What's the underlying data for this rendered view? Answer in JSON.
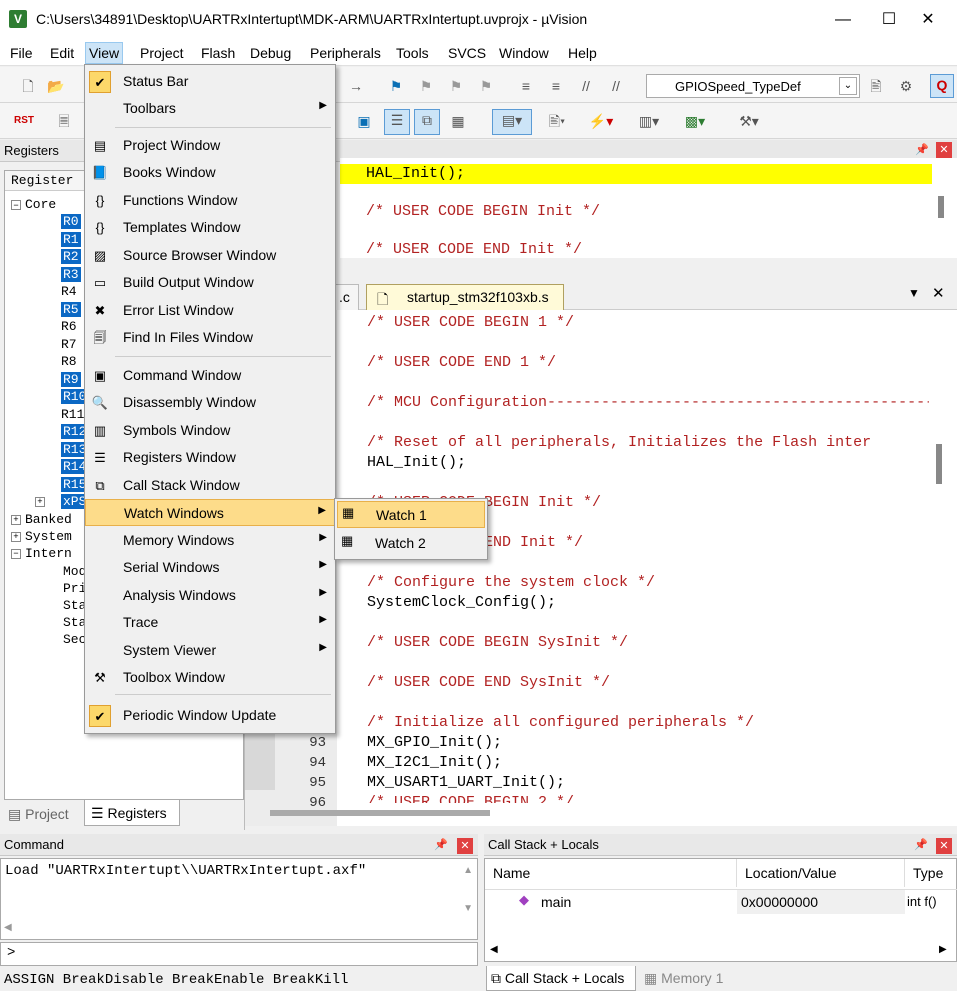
{
  "window": {
    "title": "C:\\Users\\34891\\Desktop\\UARTRxIntertupt\\MDK-ARM\\UARTRxIntertupt.uvprojx - µVision",
    "minimize": "—",
    "maximize": "☐",
    "close": "✕"
  },
  "menubar": [
    "File",
    "Edit",
    "View",
    "Project",
    "Flash",
    "Debug",
    "Peripherals",
    "Tools",
    "SVCS",
    "Window",
    "Help"
  ],
  "toolbar": {
    "target": "GPIOSpeed_TypeDef",
    "rst_label": "RST"
  },
  "view_menu": {
    "items": [
      {
        "label": "Status Bar",
        "checked": true
      },
      {
        "label": "Toolbars",
        "submenu": true
      },
      {
        "label": "Project Window"
      },
      {
        "label": "Books Window"
      },
      {
        "label": "Functions Window"
      },
      {
        "label": "Templates Window"
      },
      {
        "label": "Source Browser Window"
      },
      {
        "label": "Build Output Window"
      },
      {
        "label": "Error List Window"
      },
      {
        "label": "Find In Files Window"
      },
      {
        "label": "Command Window"
      },
      {
        "label": "Disassembly Window"
      },
      {
        "label": "Symbols Window"
      },
      {
        "label": "Registers Window"
      },
      {
        "label": "Call Stack Window"
      },
      {
        "label": "Watch Windows",
        "submenu": true,
        "highlighted": true
      },
      {
        "label": "Memory Windows",
        "submenu": true
      },
      {
        "label": "Serial Windows",
        "submenu": true
      },
      {
        "label": "Analysis Windows",
        "submenu": true
      },
      {
        "label": "Trace",
        "submenu": true
      },
      {
        "label": "System Viewer",
        "submenu": true
      },
      {
        "label": "Toolbox Window"
      },
      {
        "label": "Periodic Window Update",
        "checked": true
      }
    ]
  },
  "watch_submenu": [
    "Watch 1",
    "Watch 2"
  ],
  "registers_panel": {
    "title": "Registers",
    "column": "Register",
    "core": "Core",
    "regs": [
      "R0",
      "R1",
      "R2",
      "R3",
      "R4",
      "R5",
      "R6",
      "R7",
      "R8",
      "R9",
      "R10",
      "R11",
      "R12",
      "R13",
      "R14",
      "R15",
      "xPSR"
    ],
    "selected": [
      "R0",
      "R1",
      "R2",
      "R3",
      "R5",
      "R9",
      "R10",
      "R12",
      "R13",
      "R14",
      "R15",
      "xPSR"
    ],
    "groups": [
      "Banked",
      "System",
      "Intern"
    ],
    "internal": [
      "Mod",
      "Pri",
      "Sta",
      "Sta",
      "Sec"
    ],
    "tab_project": "Project",
    "tab_registers": "Registers"
  },
  "upper_editor": [
    "HAL_Init();",
    "/* USER CODE BEGIN Init */",
    "/* USER CODE END Init */"
  ],
  "editor_tabs": [
    ".c",
    "startup_stm32f103xb.s"
  ],
  "main_editor": {
    "lines": [
      {
        "text": "/* USER CODE BEGIN 1 */",
        "comment": true
      },
      {
        "text": "",
        "comment": false
      },
      {
        "text": "/* USER CODE END 1 */",
        "comment": true
      },
      {
        "text": "",
        "comment": false
      },
      {
        "text": "/* MCU Configuration--------------------------------------------------------",
        "comment": true
      },
      {
        "text": "",
        "comment": false
      },
      {
        "text": "/* Reset of all peripherals, Initializes the Flash inter",
        "comment": true
      },
      {
        "text": "HAL_Init();",
        "comment": false
      },
      {
        "text": "",
        "comment": false
      },
      {
        "text": "/* USER CODE BEGIN Init */",
        "comment": true
      },
      {
        "text": "",
        "comment": false
      },
      {
        "text": "/* USER CODE END Init */",
        "comment": true
      },
      {
        "text": "",
        "comment": false
      },
      {
        "text": "/* Configure the system clock */",
        "comment": true
      },
      {
        "text": "SystemClock_Config();",
        "comment": false
      },
      {
        "text": "",
        "comment": false
      },
      {
        "text": "/* USER CODE BEGIN SysInit */",
        "comment": true
      },
      {
        "text": "",
        "comment": false
      },
      {
        "text": "/* USER CODE END SysInit */",
        "comment": true
      },
      {
        "text": "",
        "comment": false
      },
      {
        "text": "/* Initialize all configured peripherals */",
        "comment": true
      },
      {
        "text": "MX_GPIO_Init();",
        "comment": false
      },
      {
        "text": "MX_I2C1_Init();",
        "comment": false
      },
      {
        "text": "MX_USART1_UART_Init();",
        "comment": false
      },
      {
        "text": "/* USER CODE BEGIN 2 */",
        "comment": true
      }
    ],
    "line_numbers": [
      "93",
      "94",
      "95",
      "96"
    ]
  },
  "command_panel": {
    "title": "Command",
    "output": "Load \"UARTRxIntertupt\\\\UARTRxIntertupt.axf\"",
    "prompt": ">",
    "hints": "ASSIGN BreakDisable BreakEnable BreakKill"
  },
  "callstack_panel": {
    "title": "Call Stack + Locals",
    "columns": [
      "Name",
      "Location/Value",
      "Type"
    ],
    "rows": [
      {
        "name": "main",
        "value": "0x00000000",
        "type": "int f()"
      }
    ],
    "tab_callstack": "Call Stack + Locals",
    "tab_memory": "Memory 1"
  }
}
